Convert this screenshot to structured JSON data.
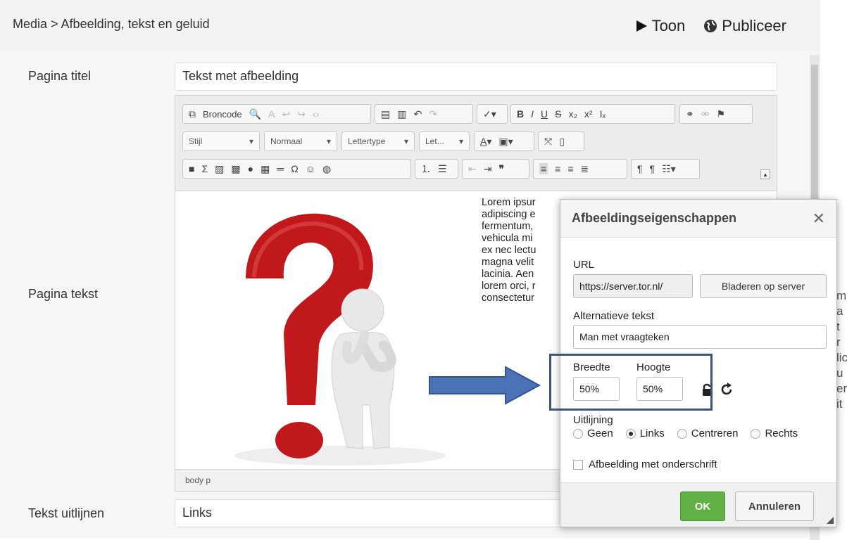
{
  "header": {
    "breadcrumb": "Media > Afbeelding, tekst en geluid",
    "toon_label": "Toon",
    "publiceer_label": "Publiceer"
  },
  "form": {
    "page_title_label": "Pagina titel",
    "page_title_value": "Tekst met afbeelding",
    "page_text_label": "Pagina tekst",
    "align_label": "Tekst uitlijnen",
    "align_value": "Links"
  },
  "toolbar": {
    "broncode": "Broncode",
    "stijl": "Stijl",
    "normaal": "Normaal",
    "lettertype": "Lettertype",
    "let": "Let..."
  },
  "editor": {
    "lorem_lines": [
      "Lorem ipsur",
      "adipiscing e",
      "fermentum,",
      "vehicula mi",
      "ex nec lectu",
      "magna velit",
      "lacinia. Aen",
      "lorem orci, r",
      "consectetur"
    ],
    "status_path": "body  p"
  },
  "dialog": {
    "title": "Afbeeldingseigenschappen",
    "url_label": "URL",
    "url_value": "https://server.tor.nl/",
    "browse_button": "Bladeren op server",
    "alt_label": "Alternatieve tekst",
    "alt_value": "Man met vraagteken",
    "width_label": "Breedte",
    "width_value": "50%",
    "height_label": "Hoogte",
    "height_value": "50%",
    "align_label": "Uitlijning",
    "align_options": [
      "Geen",
      "Links",
      "Centreren",
      "Rechts"
    ],
    "align_selected": "Links",
    "caption_label": "Afbeelding met onderschrift",
    "ok_label": "OK",
    "cancel_label": "Annuleren"
  },
  "colors": {
    "arrow": "#4a72b5",
    "highlight_border": "#3a5674",
    "ok_green": "#60b044",
    "question_mark": "#c0181b"
  },
  "background_fragments": [
    "m",
    "a",
    "t",
    "r",
    "lic",
    "u",
    "er",
    "it"
  ]
}
